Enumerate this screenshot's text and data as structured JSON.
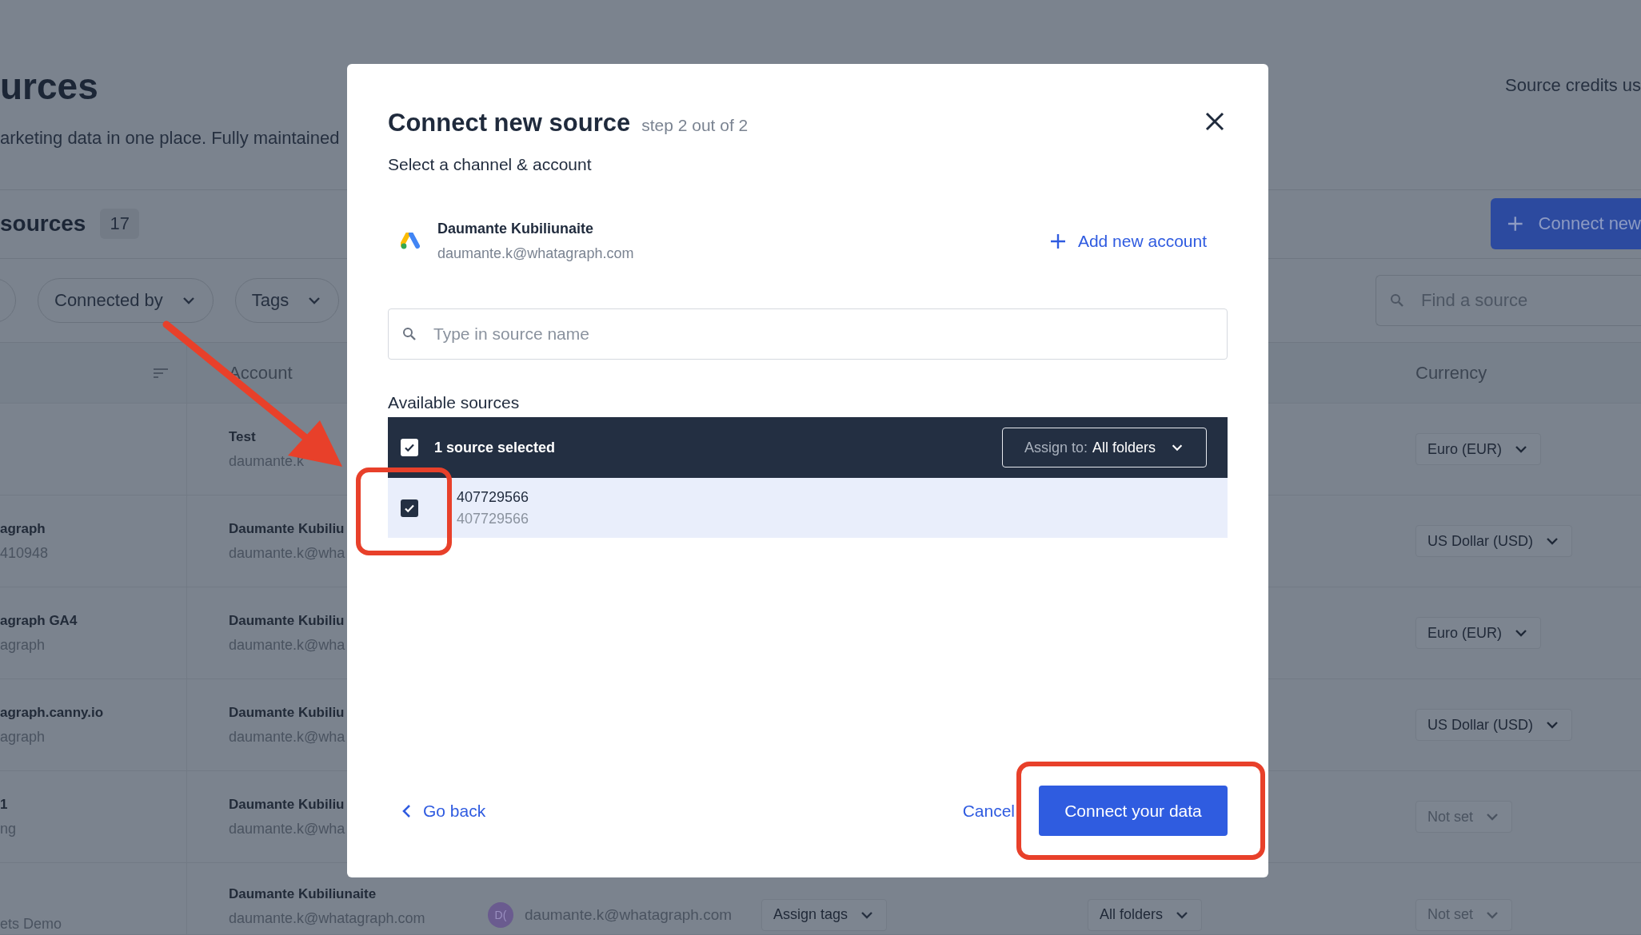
{
  "page": {
    "title": "urces",
    "subtitle": "arketing data in one place. Fully maintained",
    "credits": "Source credits us"
  },
  "sources_header": {
    "title": "sources",
    "count": "17",
    "connect_button": "Connect new"
  },
  "filters": [
    {
      "label": "Connected by"
    },
    {
      "label": "Tags"
    }
  ],
  "search": {
    "placeholder": "Find a source"
  },
  "table": {
    "columns": [
      "Account",
      "Currency"
    ],
    "rows": [
      {
        "account": "Test",
        "email": "daumante.k",
        "currency": "Euro (EUR)",
        "currency_set": true
      },
      {
        "name": "agraph",
        "sub": "410948",
        "account": "Daumante Kubiliu",
        "email": "daumante.k@wha",
        "currency": "US Dollar (USD)",
        "currency_set": true
      },
      {
        "name": "agraph GA4",
        "sub": "agraph",
        "account": "Daumante Kubiliu",
        "email": "daumante.k@wha",
        "currency": "Euro (EUR)",
        "currency_set": true
      },
      {
        "name": "agraph.canny.io",
        "sub": "agraph",
        "account": "Daumante Kubiliu",
        "email": "daumante.k@wha",
        "currency": "US Dollar (USD)",
        "currency_set": true
      },
      {
        "name": "1",
        "sub": "ng",
        "account": "Daumante Kubiliu",
        "email": "daumante.k@wha",
        "currency": "Not set",
        "currency_set": false
      },
      {
        "sub": "ets Demo",
        "account": "Daumante Kubiliunaite",
        "email": "daumante.k@whatagraph.com",
        "avatar": "D(",
        "connected_email": "daumante.k@whatagraph.com",
        "tags": "Assign tags",
        "folder": "All folders",
        "currency": "Not set",
        "currency_set": false
      }
    ]
  },
  "modal": {
    "title": "Connect new source",
    "step": "step 2 out of 2",
    "subtitle": "Select a channel & account",
    "account": {
      "name": "Daumante Kubiliunaite",
      "email": "daumante.k@whatagraph.com"
    },
    "add_account": "Add new account",
    "search": {
      "placeholder": "Type in source name"
    },
    "list_title": "Available sources",
    "selection": {
      "checked": true,
      "label": "1 source selected",
      "assign_label": "Assign to:",
      "assign_value": "All folders"
    },
    "sources": [
      {
        "name": "407729566",
        "id": "407729566",
        "checked": true
      }
    ],
    "back": "Go back",
    "cancel": "Cancel",
    "submit": "Connect your data"
  }
}
